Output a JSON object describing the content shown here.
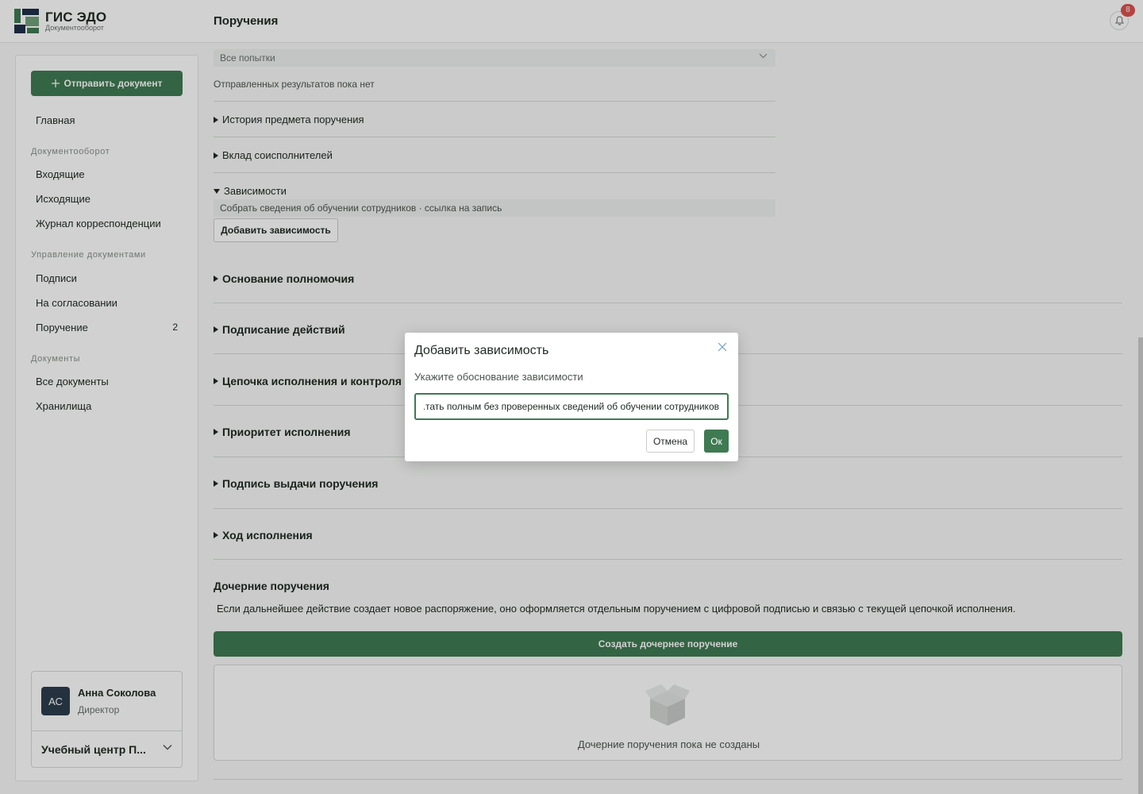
{
  "app": {
    "brand_title": "ГИС ЭДО",
    "brand_subtitle": "Документооборот",
    "page_title": "Поручения",
    "notifications_count": "8"
  },
  "sidebar": {
    "send_button": "Отправить документ",
    "home": "Главная",
    "section_docflow": "Документооборот",
    "incoming": "Входящие",
    "outgoing": "Исходящие",
    "journal": "Журнал корреспонденции",
    "section_management": "Управление документами",
    "signatures": "Подписи",
    "approval": "На согласовании",
    "assignment": "Поручение",
    "assignment_count": "2",
    "section_documents": "Документы",
    "all_documents": "Все документы",
    "storage": "Хранилища",
    "user": {
      "initials": "АС",
      "name": "Анна Соколова",
      "role": "Директор",
      "org": "Учебный центр П..."
    }
  },
  "main": {
    "attempts_select": "Все попытки",
    "no_results": "Отправленных результатов пока нет",
    "acc_history": "История предмета поручения",
    "acc_contribution": "Вклад соисполнителей",
    "acc_dependencies": "Зависимости",
    "dependency_item": "Собрать сведения об обучении сотрудников · ссылка на запись",
    "add_dependency_button": "Добавить зависимость",
    "sections": [
      "Основание полномочия",
      "Подписание действий",
      "Цепочка исполнения и контроля",
      "Приоритет исполнения",
      "Подпись выдачи поручения",
      "Ход исполнения"
    ],
    "child_title": "Дочерние поручения",
    "child_description": "Если дальнейшее действие создает новое распоряжение, оно оформляется отдельным поручением с цифровой подписью и связью с текущей цепочкой исполнения.",
    "create_child_button": "Создать дочернее поручение",
    "child_empty": "Дочерние поручения пока не созданы"
  },
  "modal": {
    "title": "Добавить зависимость",
    "label": "Укажите обоснование зависимости",
    "input_value": "тать полным без проверенных сведений об обучении сотрудников.",
    "cancel": "Отмена",
    "ok": "Ок"
  },
  "colors": {
    "accent": "#3f7a52",
    "badge": "#d9534f",
    "avatar": "#2d3e4e"
  },
  "icons": [
    "bell-icon",
    "plus-icon",
    "chevron-down-icon",
    "close-icon",
    "triangle-right-icon",
    "triangle-down-icon",
    "empty-box-icon"
  ]
}
